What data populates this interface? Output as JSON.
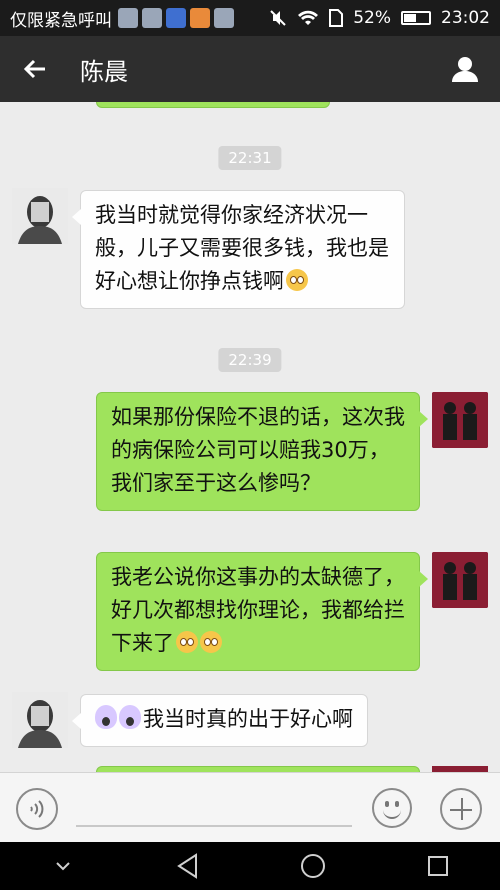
{
  "statusbar": {
    "carrier": "仅限紧急呼叫",
    "battery": "52%",
    "battery_level": 0.52,
    "time": "23:02"
  },
  "header": {
    "title": "陈晨"
  },
  "messages": [
    {
      "type": "time",
      "text": "22:31"
    },
    {
      "type": "left",
      "text": "我当时就觉得你家经济状况一般，儿子又需要很多钱，我也是好心想让你挣点钱啊"
    },
    {
      "type": "time",
      "text": "22:39"
    },
    {
      "type": "right",
      "text": "如果那份保险不退的话，这次我的病保险公司可以赔我30万，我们家至于这么惨吗？"
    },
    {
      "type": "right",
      "text": "我老公说你这事办的太缺德了，好几次都想找你理论，我都给拦下来了"
    },
    {
      "type": "left",
      "text": "我当时真的出于好心啊"
    }
  ],
  "colors": {
    "header_bg": "#2e2e2e",
    "chat_bg": "#ececec",
    "sent_bubble": "#9fe35c",
    "received_bubble": "#fefefe"
  },
  "icons": {
    "back": "back-arrow-icon",
    "profile": "person-icon",
    "voice": "voice-icon",
    "emoji": "emoji-icon",
    "more": "plus-icon"
  }
}
